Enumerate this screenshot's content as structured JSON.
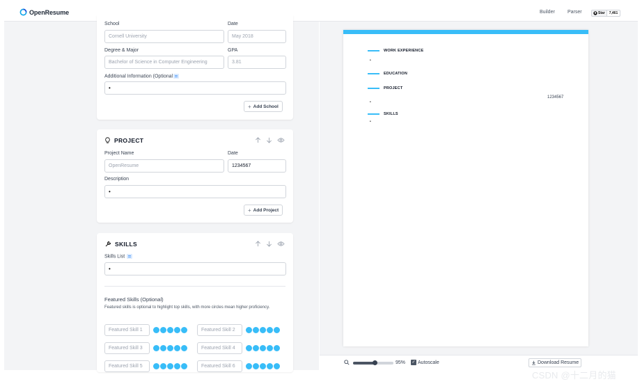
{
  "nav": {
    "app_name": "OpenResume",
    "links": [
      "Builder",
      "Parser"
    ],
    "github_star_label": "Star",
    "github_star_count": "7,461"
  },
  "education": {
    "school_label": "School",
    "school_placeholder": "Cornell University",
    "date_label": "Date",
    "date_placeholder": "May 2018",
    "degree_label": "Degree & Major",
    "degree_placeholder": "Bachelor of Science in Computer Engineering",
    "gpa_label": "GPA",
    "gpa_placeholder": "3.81",
    "additional_label": "Additional Information (Optional",
    "additional_value": "•",
    "add_button": "Add School"
  },
  "project": {
    "title": "PROJECT",
    "name_label": "Project Name",
    "name_placeholder": "OpenResume",
    "date_label": "Date",
    "date_value": "1234567",
    "description_label": "Description",
    "description_value": "•",
    "add_button": "Add Project"
  },
  "skills": {
    "title": "SKILLS",
    "list_label": "Skills List",
    "list_value": "•",
    "featured_title": "Featured Skills (Optional)",
    "featured_desc": "Featured skills is optional to highlight top skills, with more circles mean higher proficiency.",
    "featured": [
      {
        "placeholder": "Featured Skill 1",
        "level": 5
      },
      {
        "placeholder": "Featured Skill 2",
        "level": 5
      },
      {
        "placeholder": "Featured Skill 3",
        "level": 5
      },
      {
        "placeholder": "Featured Skill 4",
        "level": 5
      },
      {
        "placeholder": "Featured Skill 5",
        "level": 5
      },
      {
        "placeholder": "Featured Skill 6",
        "level": 5
      }
    ]
  },
  "preview": {
    "sections": [
      {
        "heading": "WORK EXPERIENCE",
        "bullet": "•"
      },
      {
        "heading": "EDUCATION"
      },
      {
        "heading": "PROJECT",
        "date": "1234567",
        "bullet": "•"
      },
      {
        "heading": "SKILLS",
        "bullet": "•"
      }
    ],
    "accent_color": "#38bdf8"
  },
  "toolbar": {
    "zoom": "95%",
    "zoom_fraction": 0.55,
    "autoscale_label": "Autoscale",
    "autoscale_checked": true,
    "download_label": "Download Resume"
  },
  "watermark": "CSDN @十二月的猫"
}
